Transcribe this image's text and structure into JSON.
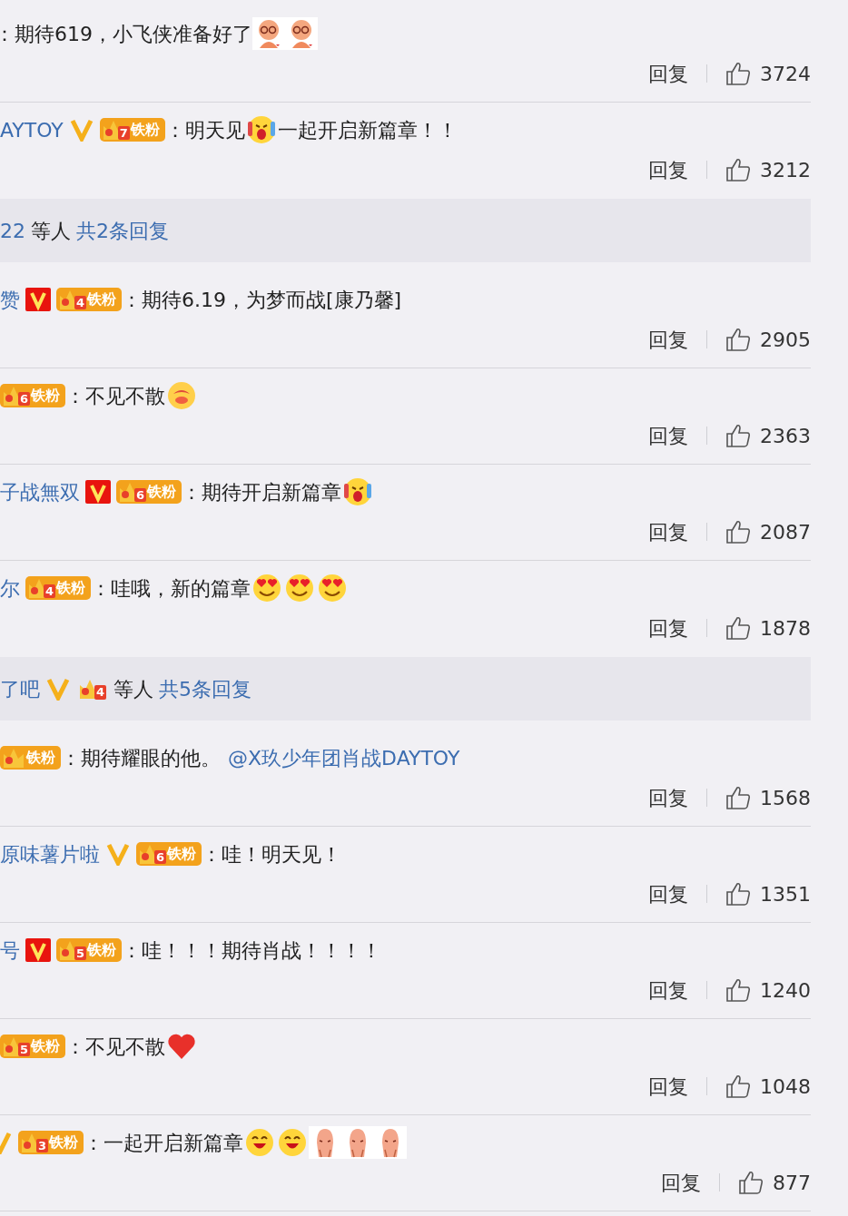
{
  "items": [
    {
      "kind": "comment",
      "content": [
        {
          "kind": "text",
          "text": "：期待619，小飞侠准备好了"
        },
        {
          "kind": "figure"
        },
        {
          "kind": "figure"
        }
      ],
      "reply": "回复",
      "likes": "3724"
    },
    {
      "kind": "comment",
      "user": "AYTOY",
      "verified": {
        "kind": "orange"
      },
      "badge": {
        "level": "7",
        "label": "铁粉"
      },
      "content": [
        {
          "kind": "text",
          "text": "：明天见"
        },
        {
          "kind": "cry"
        },
        {
          "kind": "text",
          "text": "一起开启新篇章！！"
        }
      ],
      "reply": "回复",
      "likes": "3212"
    },
    {
      "kind": "summary",
      "user": "22",
      "text": "等人",
      "link": "共2条回复"
    },
    {
      "kind": "comment",
      "user": "赞",
      "verified": {
        "kind": "red"
      },
      "badge": {
        "level": "4",
        "label": "铁粉"
      },
      "content": [
        {
          "kind": "text",
          "text": "：期待6.19，为梦而战[康乃馨]"
        }
      ],
      "reply": "回复",
      "likes": "2905"
    },
    {
      "kind": "comment",
      "badge": {
        "level": "6",
        "label": "铁粉"
      },
      "content": [
        {
          "kind": "text",
          "text": "：不见不散"
        },
        {
          "kind": "kiss"
        }
      ],
      "reply": "回复",
      "likes": "2363"
    },
    {
      "kind": "comment",
      "user": "子战無双",
      "verified": {
        "kind": "red"
      },
      "badge": {
        "level": "6",
        "label": "铁粉"
      },
      "content": [
        {
          "kind": "text",
          "text": "：期待开启新篇章"
        },
        {
          "kind": "cry"
        }
      ],
      "reply": "回复",
      "likes": "2087"
    },
    {
      "kind": "comment",
      "user": "尔",
      "badge": {
        "level": "4",
        "label": "铁粉"
      },
      "content": [
        {
          "kind": "text",
          "text": "：哇哦，新的篇章"
        },
        {
          "kind": "hearteyes"
        },
        {
          "kind": "hearteyes"
        },
        {
          "kind": "hearteyes"
        }
      ],
      "reply": "回复",
      "likes": "1878"
    },
    {
      "kind": "summary",
      "user": "了吧",
      "verified": {
        "kind": "orange"
      },
      "badge": {
        "level": "4"
      },
      "text": "等人",
      "link": "共5条回复"
    },
    {
      "kind": "comment",
      "badge": {
        "label": "铁粉"
      },
      "content": [
        {
          "kind": "text",
          "text": "：期待耀眼的他。"
        },
        {
          "kind": "mention",
          "text": "@X玖少年团肖战DAYTOY"
        }
      ],
      "reply": "回复",
      "likes": "1568"
    },
    {
      "kind": "comment",
      "user": "原味薯片啦",
      "verified": {
        "kind": "orange"
      },
      "badge": {
        "level": "6",
        "label": "铁粉"
      },
      "content": [
        {
          "kind": "text",
          "text": "：哇！明天见！"
        }
      ],
      "reply": "回复",
      "likes": "1351"
    },
    {
      "kind": "comment",
      "user": "号",
      "verified": {
        "kind": "red"
      },
      "badge": {
        "level": "5",
        "label": "铁粉"
      },
      "content": [
        {
          "kind": "text",
          "text": "：哇！！！期待肖战！！！！"
        }
      ],
      "reply": "回复",
      "likes": "1240"
    },
    {
      "kind": "comment",
      "badge": {
        "level": "5",
        "label": "铁粉"
      },
      "content": [
        {
          "kind": "text",
          "text": "：不见不散"
        },
        {
          "kind": "heart"
        }
      ],
      "reply": "回复",
      "likes": "1048"
    },
    {
      "kind": "comment",
      "verified": {
        "kind": "clipped"
      },
      "badge": {
        "level": "3",
        "label": "铁粉"
      },
      "content": [
        {
          "kind": "text",
          "text": "：一起开启新篇章"
        },
        {
          "kind": "laugh"
        },
        {
          "kind": "laugh"
        },
        {
          "kind": "shy"
        },
        {
          "kind": "shy"
        },
        {
          "kind": "shy"
        }
      ],
      "reply": "回复",
      "likes": "877"
    }
  ]
}
